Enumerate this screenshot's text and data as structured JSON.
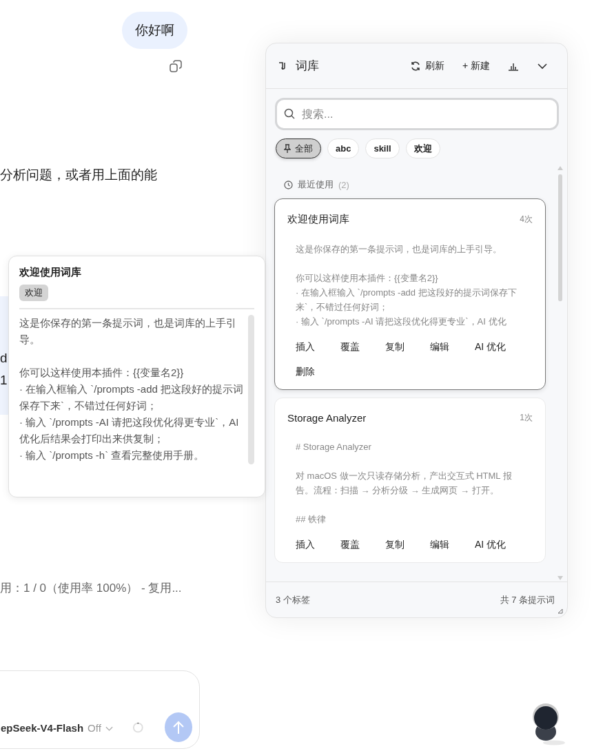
{
  "chat": {
    "user_message": "你好啊",
    "reply_fragment": "分析问题，或者用上面的能",
    "side_fragments": [
      "d",
      "1"
    ],
    "usage_text": "用：1 / 0（使用率 100%） - 复用...",
    "composer": {
      "model": "epSeek-V4-Flash",
      "mode": "Off"
    }
  },
  "panel": {
    "title": "词库",
    "actions": [
      {
        "kind": "refresh",
        "label": "刷新"
      },
      {
        "kind": "new",
        "label": "+ 新建"
      },
      {
        "kind": "stats"
      },
      {
        "kind": "collapse"
      }
    ],
    "search": {
      "placeholder": "搜索..."
    },
    "tags": [
      {
        "label": "全部",
        "selected": true,
        "pinned": true
      },
      {
        "label": "abc",
        "selected": false,
        "pinned": false
      },
      {
        "label": "skill",
        "selected": false,
        "pinned": false
      },
      {
        "label": "欢迎",
        "selected": false,
        "pinned": false
      }
    ],
    "section": {
      "title": "最近使用",
      "count": "(2)"
    },
    "prompts": [
      {
        "title": "欢迎使用词库",
        "uses": "4次",
        "selected": true,
        "paragraphs": [
          [
            "这是你保存的第一条提示词，也是词库的上手引导。"
          ],
          [
            "你可以这样使用本插件：{{变量名2}}",
            "· 在输入框输入 `/prompts -add 把这段好的提示词保存下来`，不错过任何好词；",
            "· 输入 `/prompts -AI 请把这段优化得更专业`，AI 优化"
          ]
        ],
        "actions": [
          "插入",
          "覆盖",
          "复制",
          "编辑",
          "AI 优化",
          "删除"
        ]
      },
      {
        "title": "Storage Analyzer",
        "uses": "1次",
        "selected": false,
        "paragraphs": [
          [
            "# Storage Analyzer"
          ],
          [
            "对 macOS 做一次只读存储分析，产出交互式 HTML 报告。流程：扫描 → 分析分级 → 生成网页 → 打开。"
          ],
          [
            "## 铁律"
          ]
        ],
        "actions": [
          "插入",
          "覆盖",
          "复制",
          "编辑",
          "AI 优化"
        ]
      }
    ],
    "footer": {
      "tag_count": "3 个标签",
      "total": "共 7 条提示词"
    }
  },
  "preview": {
    "title": "欢迎使用词库",
    "tag": "欢迎",
    "paragraphs": [
      [
        "这是你保存的第一条提示词，也是词库的上手引导。"
      ],
      [
        "你可以这样使用本插件：{{变量名2}}",
        "· 在输入框输入 `/prompts -add 把这段好的提示词保存下来`，不错过任何好词；",
        "· 输入 `/prompts -AI 请把这段优化得更专业`，AI 优化后结果会打印出来供复制；",
        "· 输入 `/prompts -h` 查看完整使用手册。"
      ]
    ]
  }
}
